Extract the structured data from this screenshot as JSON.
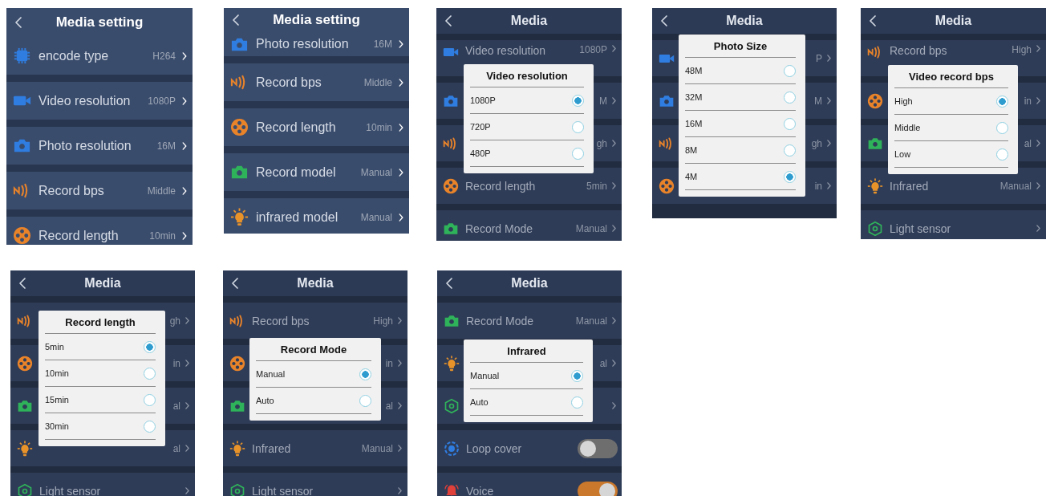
{
  "screens": [
    {
      "title": "Media setting",
      "rows": [
        {
          "kind": "link",
          "label": "encode type",
          "value": "H264"
        },
        {
          "kind": "link",
          "label": "Video resolution",
          "value": "1080P"
        },
        {
          "kind": "link",
          "label": "Photo resolution",
          "value": "16M"
        },
        {
          "kind": "link",
          "label": "Record bps",
          "value": "Middle"
        },
        {
          "kind": "link",
          "label": "Record length",
          "value": "10min"
        }
      ]
    },
    {
      "title": "Media setting",
      "rows": [
        {
          "kind": "link",
          "label": "Photo resolution",
          "value": "16M"
        },
        {
          "kind": "link",
          "label": "Record bps",
          "value": "Middle"
        },
        {
          "kind": "link",
          "label": "Record length",
          "value": "10min"
        },
        {
          "kind": "link",
          "label": "Record model",
          "value": "Manual"
        },
        {
          "kind": "link",
          "label": "infrared model",
          "value": "Manual"
        }
      ]
    },
    {
      "title": "Media",
      "rows": [
        {
          "kind": "link",
          "label": "Video resolution",
          "value": "1080P"
        },
        {
          "kind": "link",
          "value": "M"
        },
        {
          "kind": "link",
          "value": "gh"
        },
        {
          "kind": "link",
          "label": "Record length",
          "value": "5min"
        },
        {
          "kind": "link",
          "label": "Record Mode",
          "value": "Manual"
        }
      ],
      "dialog": {
        "title": "Video resolution",
        "options": [
          {
            "label": "1080P",
            "selected": true
          },
          {
            "label": "720P",
            "selected": false
          },
          {
            "label": "480P",
            "selected": false
          }
        ]
      }
    },
    {
      "title": "Media",
      "rows": [
        {
          "kind": "link",
          "value": "P"
        },
        {
          "kind": "link",
          "value": "M"
        },
        {
          "kind": "link",
          "value": "gh"
        },
        {
          "kind": "link",
          "value": "in"
        }
      ],
      "dialog": {
        "title": "Photo Size",
        "options": [
          {
            "label": "48M",
            "selected": false
          },
          {
            "label": "32M",
            "selected": false
          },
          {
            "label": "16M",
            "selected": false
          },
          {
            "label": "8M",
            "selected": false
          },
          {
            "label": "4M",
            "selected": true
          }
        ]
      }
    },
    {
      "title": "Media",
      "rows": [
        {
          "kind": "link",
          "label": "Record bps",
          "value": "High"
        },
        {
          "kind": "link",
          "value": "in"
        },
        {
          "kind": "link",
          "value": "al"
        },
        {
          "kind": "link",
          "label": "Infrared",
          "value": "Manual"
        },
        {
          "kind": "link",
          "label": "Light sensor"
        }
      ],
      "dialog": {
        "title": "Video record bps",
        "options": [
          {
            "label": "High",
            "selected": true
          },
          {
            "label": "Middle",
            "selected": false
          },
          {
            "label": "Low",
            "selected": false
          }
        ]
      }
    },
    {
      "title": "Media",
      "rows": [
        {
          "kind": "link",
          "value": "gh"
        },
        {
          "kind": "link",
          "value": "in"
        },
        {
          "kind": "link",
          "value": "al"
        },
        {
          "kind": "link",
          "value": "al"
        },
        {
          "kind": "link",
          "label": "Light sensor"
        }
      ],
      "dialog": {
        "title": "Record length",
        "options": [
          {
            "label": "5min",
            "selected": true
          },
          {
            "label": "10min",
            "selected": false
          },
          {
            "label": "15min",
            "selected": false
          },
          {
            "label": "30min",
            "selected": false
          }
        ]
      }
    },
    {
      "title": "Media",
      "rows": [
        {
          "kind": "link",
          "label": "Record bps",
          "value": "High"
        },
        {
          "kind": "link",
          "value": "in"
        },
        {
          "kind": "link",
          "value": "al"
        },
        {
          "kind": "link",
          "label": "Infrared",
          "value": "Manual"
        },
        {
          "kind": "link",
          "label": "Light sensor"
        }
      ],
      "dialog": {
        "title": "Record Mode",
        "options": [
          {
            "label": "Manual",
            "selected": true
          },
          {
            "label": "Auto",
            "selected": false
          }
        ]
      }
    },
    {
      "title": "Media",
      "rows": [
        {
          "kind": "link",
          "label": "Record Mode",
          "value": "Manual"
        },
        {
          "kind": "link",
          "value": "al"
        },
        {
          "kind": "link"
        },
        {
          "kind": "toggle",
          "label": "Loop cover",
          "on": false
        },
        {
          "kind": "toggle",
          "label": "Voice",
          "on": true
        }
      ],
      "dialog": {
        "title": "Infrared",
        "options": [
          {
            "label": "Manual",
            "selected": true
          },
          {
            "label": "Auto",
            "selected": false
          }
        ]
      }
    }
  ]
}
